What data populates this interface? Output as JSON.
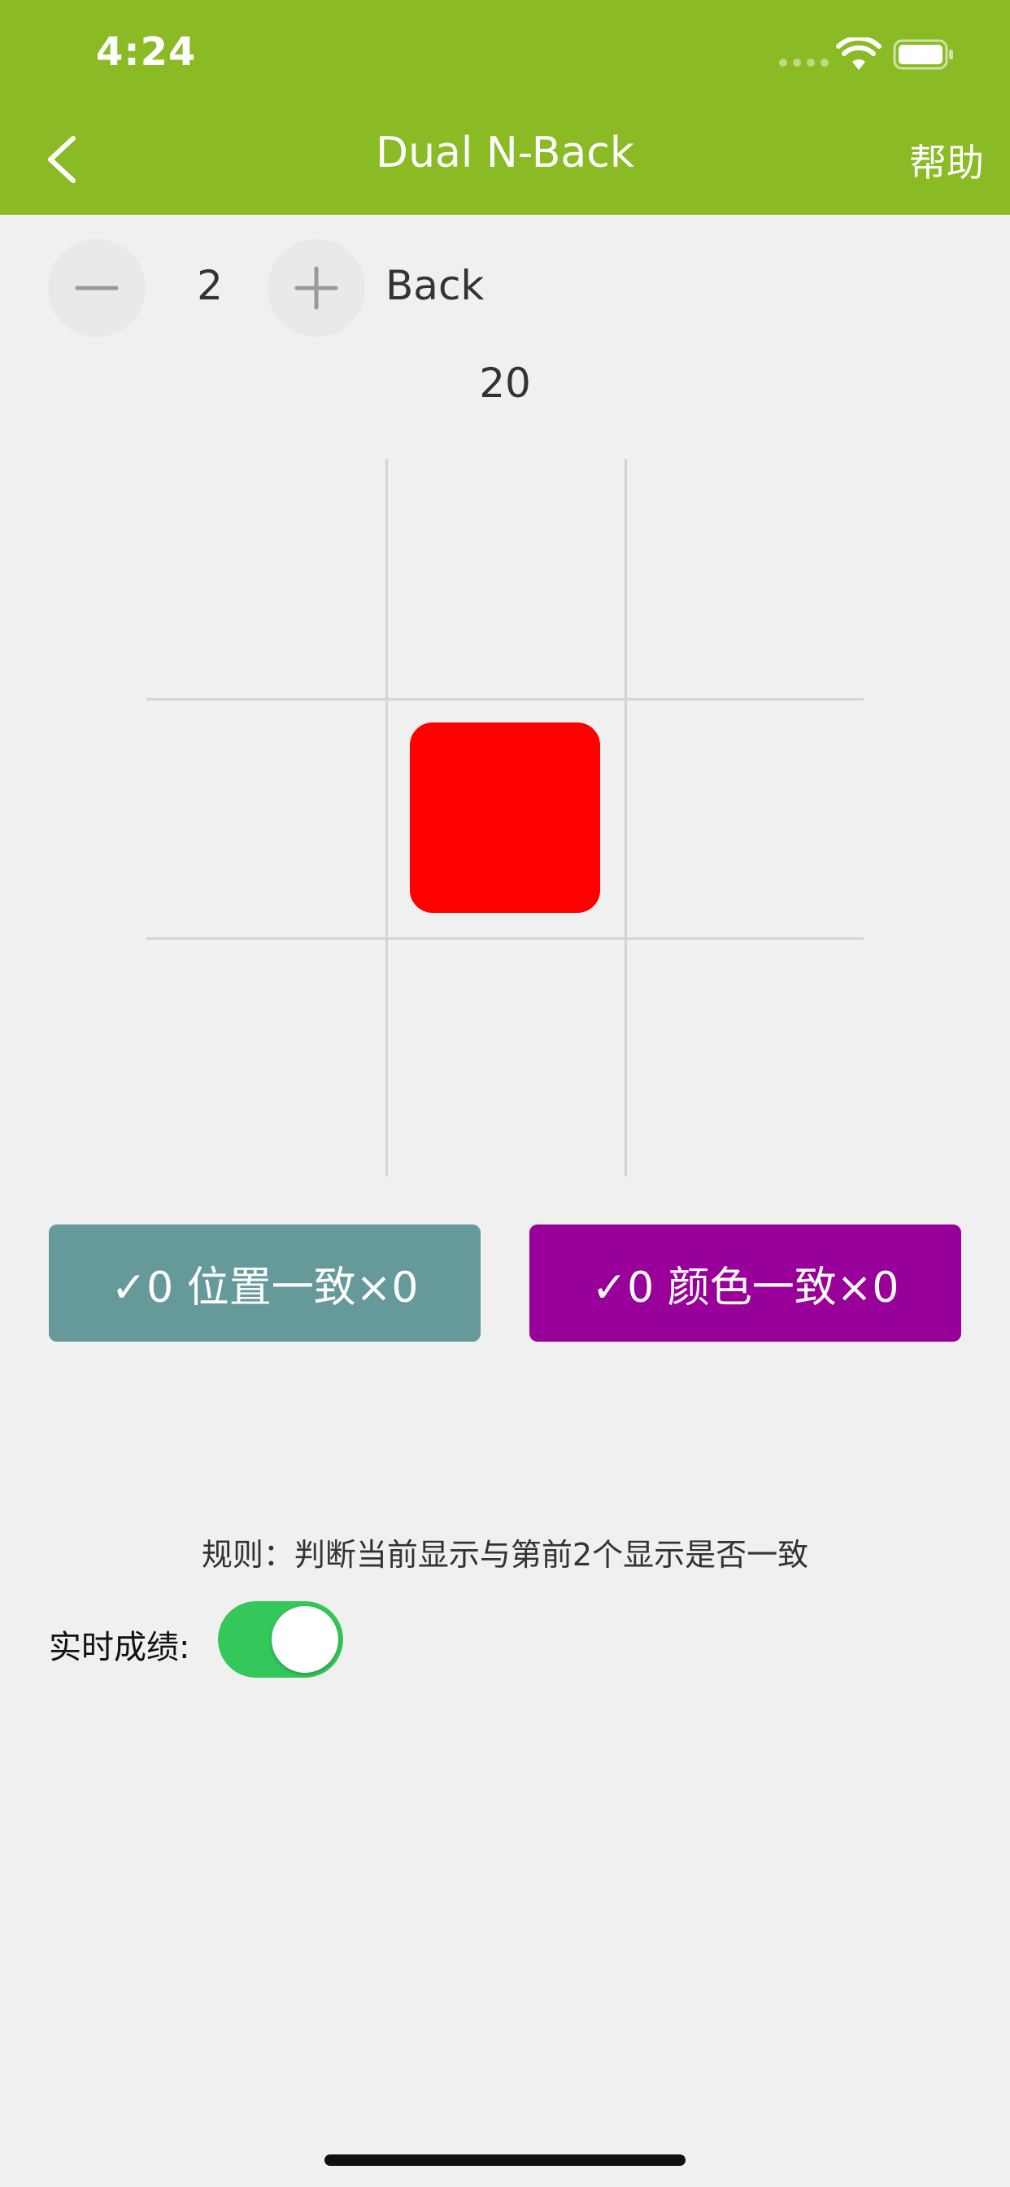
{
  "status_bar": {
    "time": "4:24",
    "icons": [
      "signal-dots",
      "wifi-icon",
      "battery-icon"
    ]
  },
  "nav": {
    "back_icon": "chevron-left-icon",
    "title": "Dual N-Back",
    "help_label": "帮助"
  },
  "level": {
    "decrement_icon": "minus-icon",
    "value": "2",
    "increment_icon": "plus-icon",
    "suffix": "Back"
  },
  "remaining": "20",
  "grid": {
    "rows": 3,
    "cols": 3,
    "active_cell": {
      "row": 1,
      "col": 1
    },
    "stimulus_color": "#ff0000"
  },
  "buttons": {
    "position_label": "✓0 位置一致×0",
    "position_color": "#669999",
    "color_label": "✓0 颜色一致×0",
    "color_color": "#990099"
  },
  "rule": "规则：判断当前显示与第前2个显示是否一致",
  "live_score": {
    "label": "实时成绩:",
    "enabled": true,
    "on_color": "#34c759"
  },
  "theme": {
    "header_color": "#8aba24",
    "background": "#f0f0f0"
  }
}
